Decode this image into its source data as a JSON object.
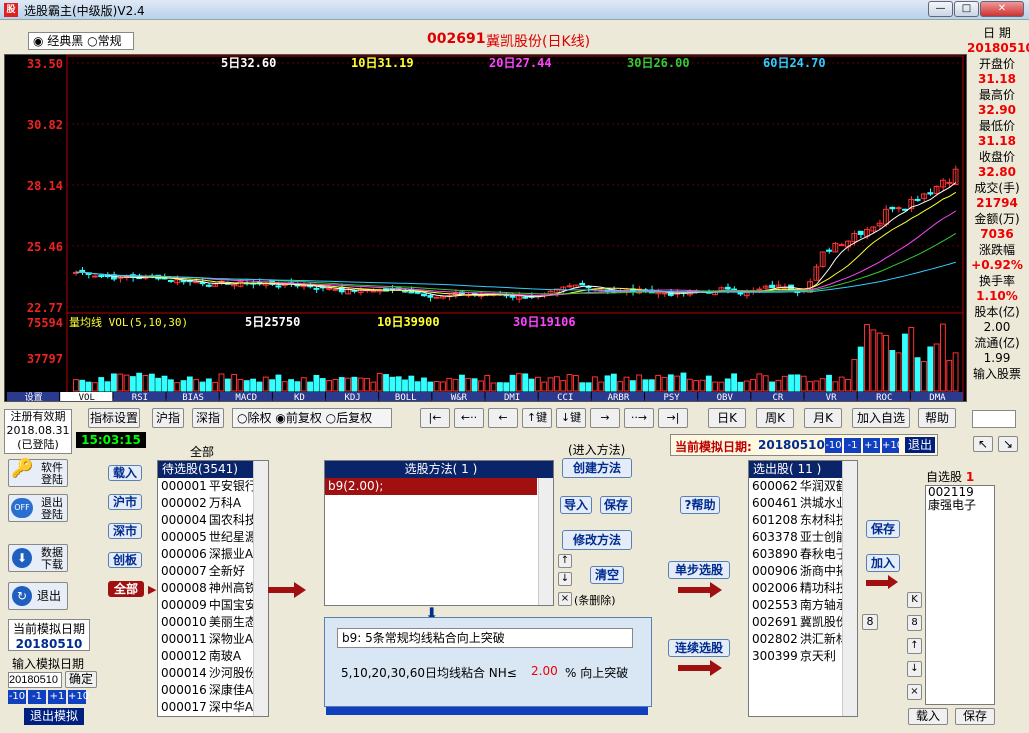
{
  "window": {
    "title": "选股霸主(中级版)V2.4",
    "icon": "app-icon"
  },
  "header": {
    "radio_classic": "经典黑",
    "radio_normal": "常规",
    "stock_code": "002691",
    "stock_name": "冀凯股份(日K线)"
  },
  "ma_labels": [
    {
      "text": "5日32.60",
      "color": "#ffffff"
    },
    {
      "text": "10日31.19",
      "color": "#ffff33"
    },
    {
      "text": "20日27.44",
      "color": "#ff44ff"
    },
    {
      "text": "30日26.00",
      "color": "#33cc33"
    },
    {
      "text": "60日24.70",
      "color": "#33ccff"
    }
  ],
  "vol_labels": {
    "title": "量均线 VOL(5,10,30)",
    "v5": "5日25750",
    "v10": "10日39900",
    "v30": "30日19106"
  },
  "price_axis": [
    "33.50",
    "30.82",
    "28.14",
    "25.46",
    "22.77"
  ],
  "vol_axis": [
    "75594",
    "37797"
  ],
  "tabs": [
    "设置",
    "VOL",
    "RSI",
    "BIAS",
    "MACD",
    "KD",
    "KDJ",
    "BOLL",
    "W&R",
    "DMI",
    "CCI",
    "ARBR",
    "PSY",
    "OBV",
    "CR",
    "VR",
    "ROC",
    "DMA"
  ],
  "info": {
    "date_label": "日 期",
    "date_value": "20180510",
    "items": [
      {
        "label": "开盘价",
        "value": "31.18"
      },
      {
        "label": "最高价",
        "value": "32.90"
      },
      {
        "label": "最低价",
        "value": "31.18"
      },
      {
        "label": "收盘价",
        "value": "32.80"
      },
      {
        "label": "成交(手)",
        "value": "21794"
      },
      {
        "label": "金额(万)",
        "value": "7036"
      },
      {
        "label": "涨跌幅",
        "value": "+0.92%"
      },
      {
        "label": "换手率",
        "value": "1.10%"
      }
    ],
    "equity_label": "股本(亿)",
    "equity_value": "2.00",
    "float_label": "流通(亿)",
    "float_value": "1.99",
    "input_stock_label": "输入股票"
  },
  "toolbar": {
    "reg_line1": "注册有效期",
    "reg_line2": "2018.08.31",
    "reg_line3": "(已登陆)",
    "indicator_set": "指标设置",
    "sh_index": "沪指",
    "sz_index": "深指",
    "rights_none": "除权",
    "rights_pre": "前复权",
    "rights_post": "后复权",
    "nav": [
      "|←",
      "←··",
      "←",
      "↑键",
      "↓键",
      "→",
      "··→",
      "→|"
    ],
    "day_k": "日K",
    "week_k": "周K",
    "month_k": "月K",
    "add_fav": "加入自选",
    "help": "帮助",
    "time": "15:03:15"
  },
  "sim": {
    "current_label": "当前模拟日期:",
    "current_date": "20180510",
    "btns": [
      "-10",
      "-1",
      "+1",
      "+10"
    ],
    "exit": "退出"
  },
  "left_panel": {
    "soft_login": "软件登陆",
    "exit_login": "退出登陆",
    "data_download": "数据下载",
    "exit": "退出",
    "sim_date_label": "当前模拟日期",
    "sim_date": "20180510",
    "input_sim_label": "输入模拟日期",
    "sim_input": "20180510",
    "confirm": "确定",
    "btns": [
      "-10",
      "-1",
      "+1",
      "+10"
    ],
    "exit_sim": "退出模拟"
  },
  "market": {
    "all_label": "全部",
    "load": "载入",
    "sh": "沪市",
    "sz": "深市",
    "gem": "创板",
    "all": "全部"
  },
  "pool": {
    "title": "待选股(3541)",
    "rows": [
      [
        "000001",
        "平安银行"
      ],
      [
        "000002",
        "万科A"
      ],
      [
        "000004",
        "国农科技"
      ],
      [
        "000005",
        "世纪星源"
      ],
      [
        "000006",
        "深振业A"
      ],
      [
        "000007",
        "全新好"
      ],
      [
        "000008",
        "神州高铁"
      ],
      [
        "000009",
        "中国宝安"
      ],
      [
        "000010",
        "美丽生态"
      ],
      [
        "000011",
        "深物业A"
      ],
      [
        "000012",
        "南玻A"
      ],
      [
        "000014",
        "沙河股份"
      ],
      [
        "000016",
        "深康佳A"
      ],
      [
        "000017",
        "深中华A"
      ]
    ]
  },
  "method": {
    "enter_label": "(进入方法)",
    "title": "选股方法(  1  )",
    "item": "b9(2.00);",
    "create": "创建方法",
    "import": "导入",
    "save": "保存",
    "modify": "修改方法",
    "clear": "清空",
    "delete_note": "(条删除)",
    "desc_title": "b9: 5条常规均线粘合向上突破",
    "desc_text_a": "5,10,20,30,60日均线粘合 NH≤",
    "desc_value": "2.00",
    "desc_text_b": "%   向上突破"
  },
  "actions": {
    "help": "?帮助",
    "step": "单步选股",
    "continuous": "连续选股"
  },
  "result": {
    "title": "选出股( 11 )",
    "rows": [
      [
        "600062",
        "华润双鹤"
      ],
      [
        "600461",
        "洪城水业"
      ],
      [
        "601208",
        "东材科技"
      ],
      [
        "603378",
        "亚士创能"
      ],
      [
        "603890",
        "春秋电子"
      ],
      [
        "000906",
        "浙商中拓"
      ],
      [
        "002006",
        "精功科技"
      ],
      [
        "002553",
        "南方轴承"
      ],
      [
        "002691",
        "冀凯股份"
      ],
      [
        "002802",
        "洪汇新材"
      ],
      [
        "300399",
        "京天利"
      ]
    ]
  },
  "favorites": {
    "save": "保存",
    "add": "加入",
    "count_label": "8",
    "title": "自选股",
    "count": "1",
    "rows": [
      [
        "002119",
        "康强电子"
      ]
    ],
    "load": "载入",
    "save2": "保存",
    "side_btns": [
      "K",
      "8",
      "↑",
      "↓",
      "×"
    ]
  },
  "colors": {
    "up": "#ff3333",
    "down": "#33ffff",
    "ma5": "#ffffff",
    "ma10": "#ffff33",
    "ma20": "#ff44ff",
    "ma30": "#33cc33",
    "ma60": "#33ccff",
    "red_text": "#e00000"
  },
  "chart_data": {
    "type": "candlestick",
    "ylim": [
      22.77,
      33.5
    ],
    "ticks": [
      "33.50",
      "30.82",
      "28.14",
      "25.46",
      "22.77"
    ],
    "volume_ticks": [
      "75594",
      "37797"
    ]
  }
}
